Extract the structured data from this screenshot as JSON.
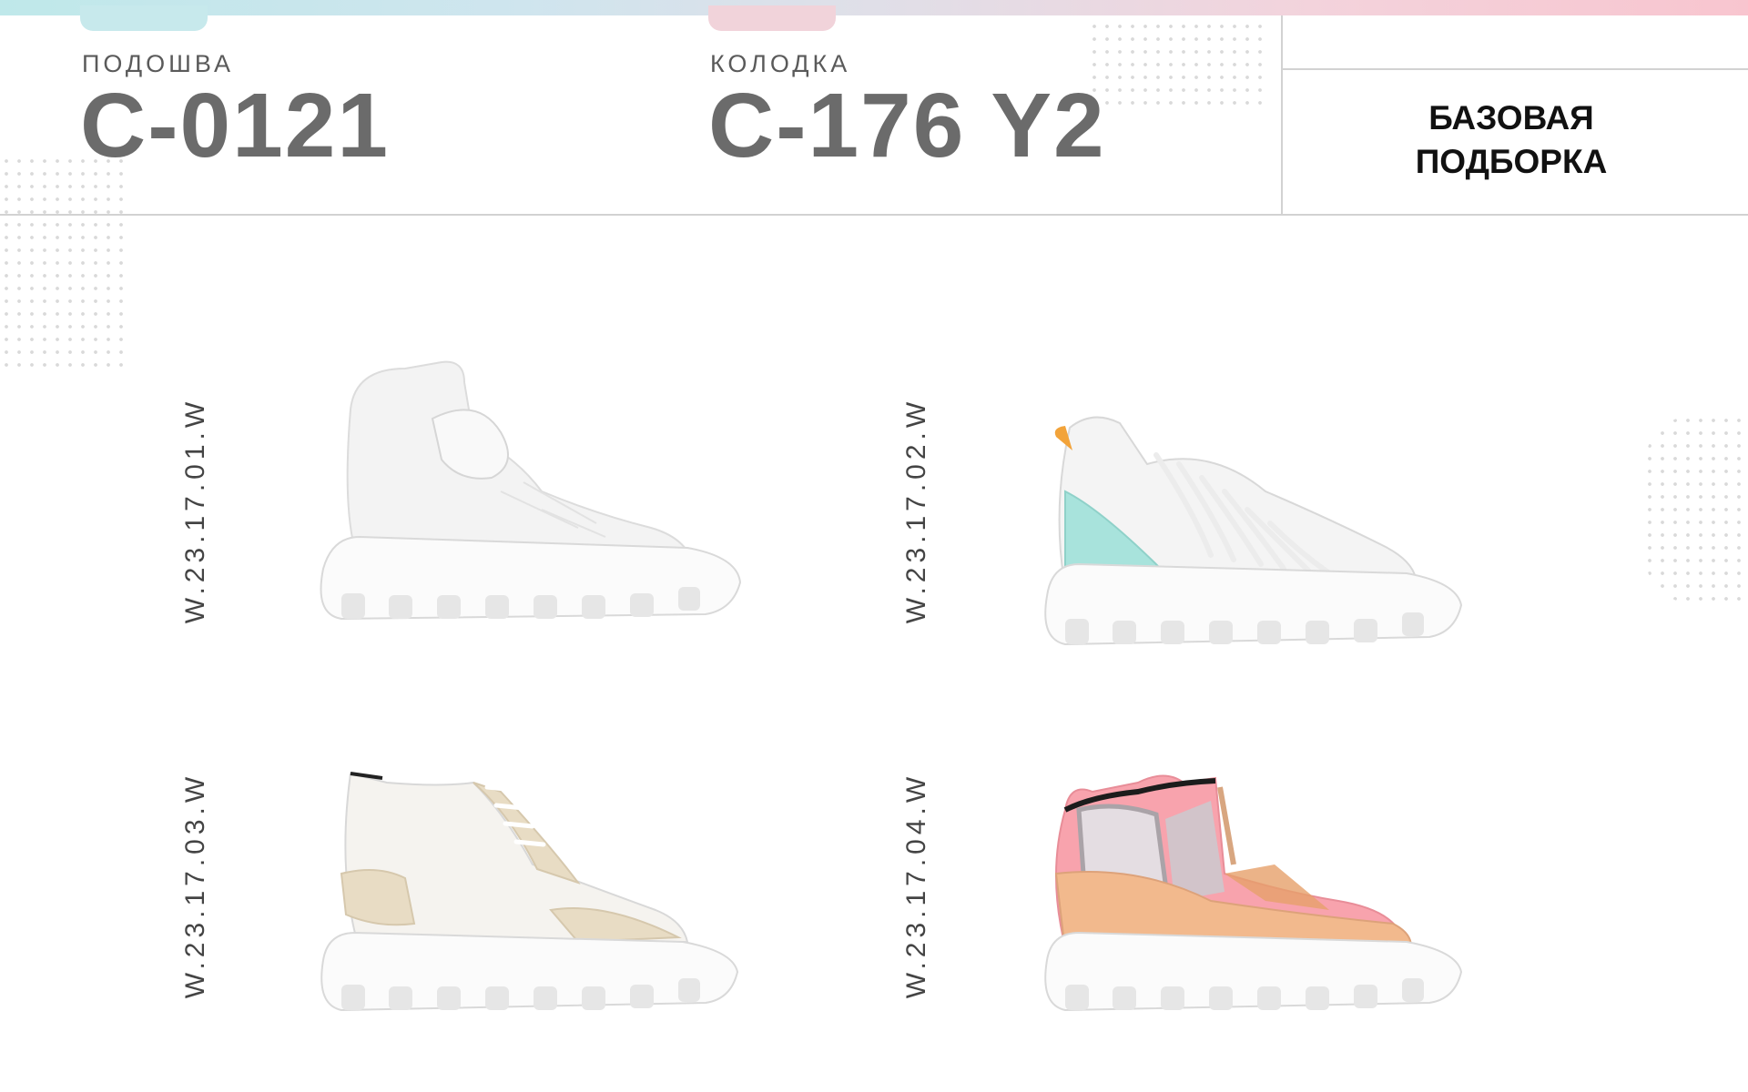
{
  "header": {
    "sole_label": "ПОДОШВА",
    "sole_code": "C-0121",
    "last_label": "КОЛОДКА",
    "last_code": "C-176 Y2",
    "collection_line1": "БАЗОВАЯ",
    "collection_line2": "ПОДБОРКА"
  },
  "products": [
    {
      "sku": "W.23.17.01.W",
      "image": "white-high-top-sneaker-strap-icon"
    },
    {
      "sku": "W.23.17.02.W",
      "image": "white-lace-sneaker-mint-heel-icon"
    },
    {
      "sku": "W.23.17.03.W",
      "image": "white-beige-suede-sneaker-icon"
    },
    {
      "sku": "W.23.17.04.W",
      "image": "pink-mesh-zip-sneaker-icon"
    }
  ],
  "colors": {
    "mint": "#a8e3dc",
    "pink": "#f8a3ad",
    "beige": "#e8dcc4",
    "peach": "#f2b98d"
  }
}
